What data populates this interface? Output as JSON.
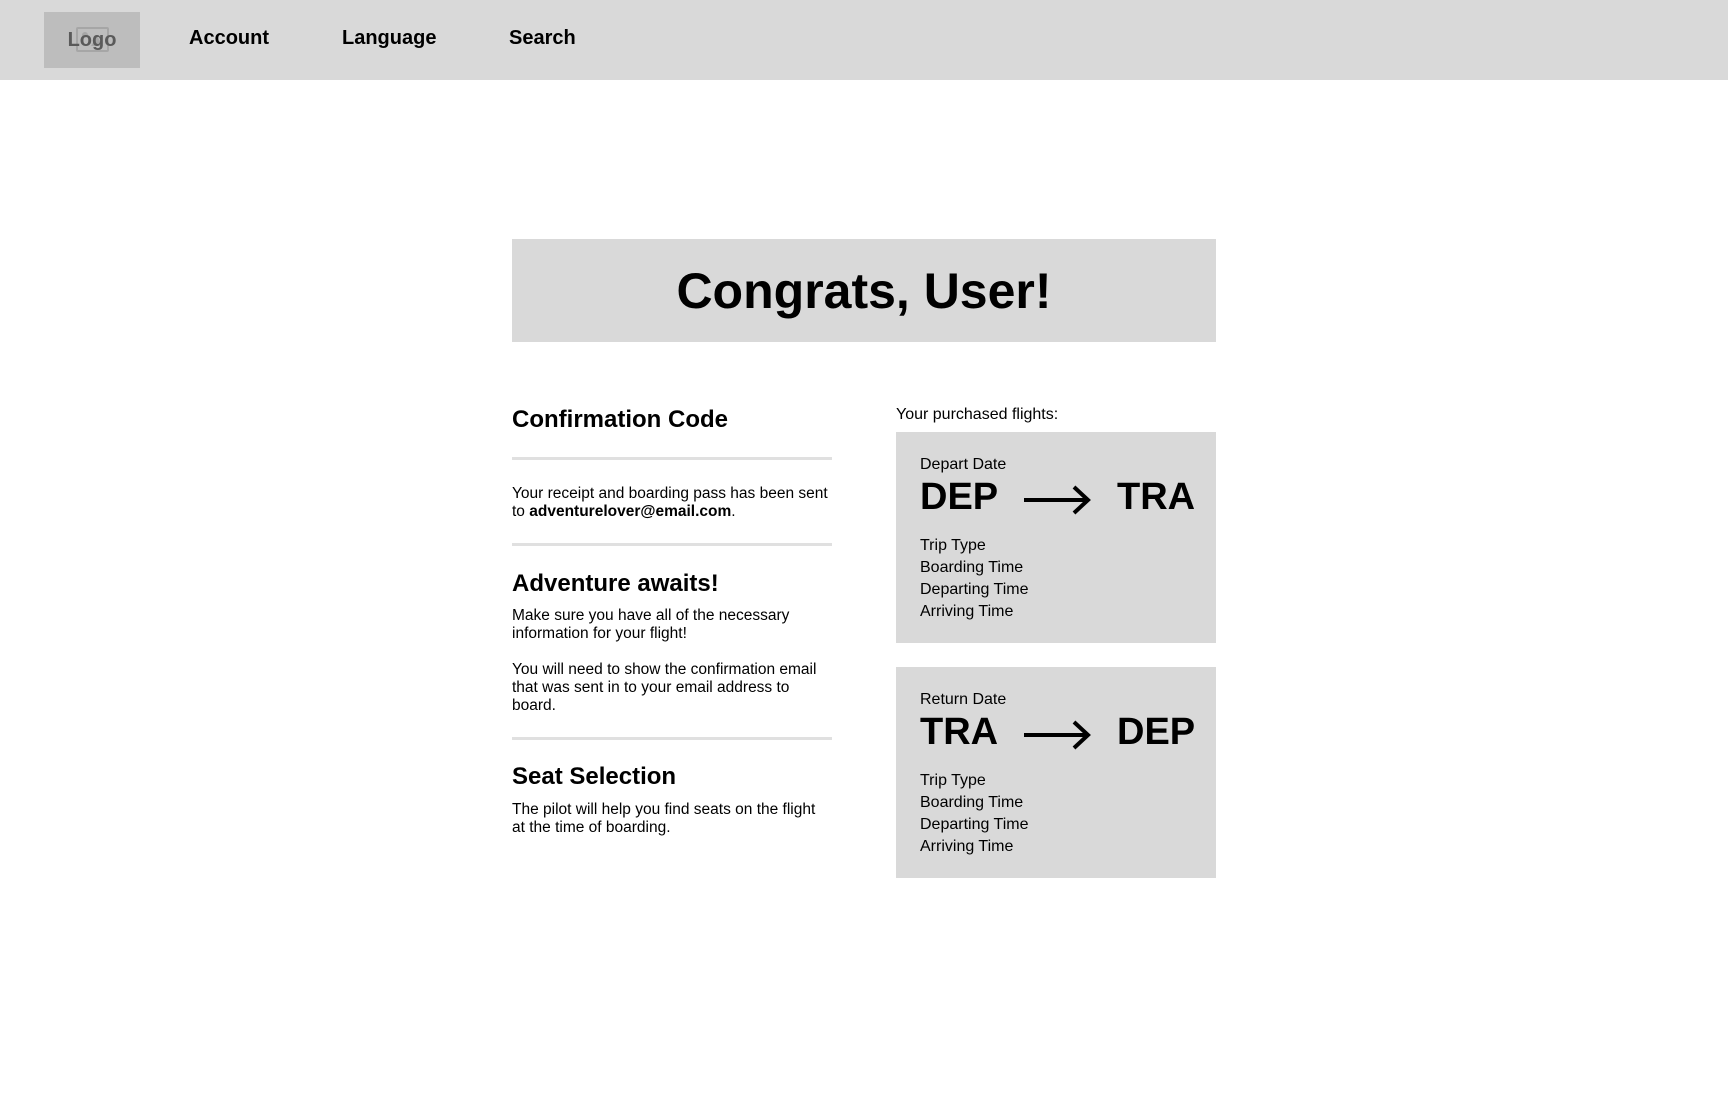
{
  "topbar": {
    "logo_label": "Logo",
    "nav": [
      {
        "label": "Account"
      },
      {
        "label": "Language"
      },
      {
        "label": "Search"
      }
    ]
  },
  "hero": {
    "title": "Congrats, User!"
  },
  "confirmation": {
    "heading": "Confirmation Code",
    "receipt_text": "Your receipt and boarding pass has been sent to ",
    "email": "adventurelover@email.com",
    "receipt_suffix": "."
  },
  "adventure": {
    "heading": "Adventure awaits!",
    "para1": "Make sure you have all of the necessary information for your flight!",
    "para2": "You will need to show the confirmation email that was sent in to your email address to board."
  },
  "seat": {
    "heading": "Seat Selection",
    "text": "The pilot will help you find seats on the flight at the time of boarding."
  },
  "flights": {
    "label": "Your purchased flights:",
    "cards": [
      {
        "date_label": "Depart Date",
        "from": "DEP",
        "to": "TRA",
        "arrow_icon": "arrow-right",
        "details": [
          "Trip Type",
          "Boarding Time",
          "Departing Time",
          "Arriving Time"
        ]
      },
      {
        "date_label": "Return Date",
        "from": "TRA",
        "to": "DEP",
        "arrow_icon": "arrow-right",
        "details": [
          "Trip Type",
          "Boarding Time",
          "Departing Time",
          "Arriving Time"
        ]
      }
    ]
  }
}
